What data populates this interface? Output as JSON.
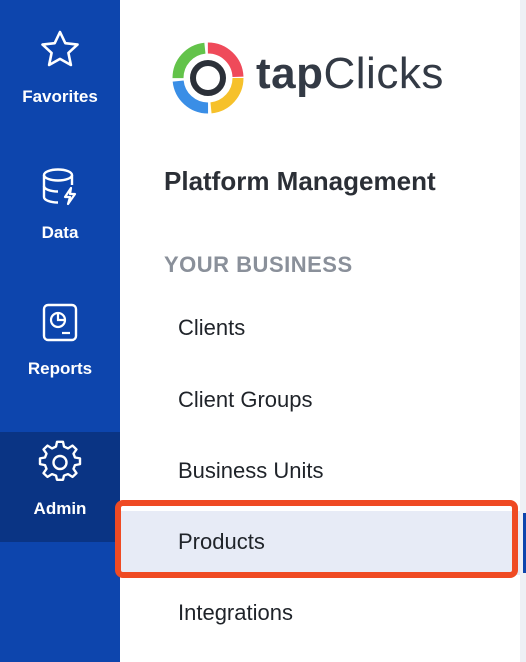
{
  "colors": {
    "rail": "#0d45ad",
    "rail_active": "#0a3484",
    "highlight": "#ef4a23",
    "selected_bg": "#e7ebf6"
  },
  "rail": {
    "items": [
      {
        "label": "Favorites",
        "icon": "star-icon"
      },
      {
        "label": "Data",
        "icon": "database-icon"
      },
      {
        "label": "Reports",
        "icon": "report-icon"
      },
      {
        "label": "Admin",
        "icon": "gear-icon",
        "active": true
      }
    ]
  },
  "logo": {
    "text_bold": "tap",
    "text_regular": "Clicks"
  },
  "panel": {
    "title": "Platform Management",
    "section": "YOUR BUSINESS",
    "items": [
      {
        "label": "Clients"
      },
      {
        "label": "Client Groups"
      },
      {
        "label": "Business Units"
      },
      {
        "label": "Products",
        "selected": true
      },
      {
        "label": "Integrations"
      }
    ]
  }
}
